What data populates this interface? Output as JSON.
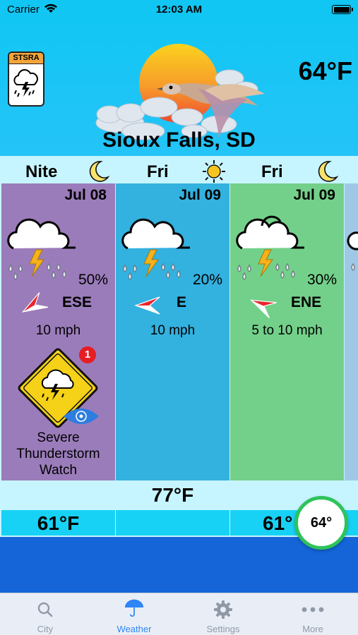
{
  "status_bar": {
    "carrier": "Carrier",
    "time": "12:03 AM"
  },
  "header": {
    "badge_label": "STSRA",
    "current_temp": "64°F",
    "city": "Sioux Falls, SD"
  },
  "forecast": [
    {
      "day": "Nite",
      "day_icon": "moon-icon",
      "date": "Jul 08",
      "precip": "50%",
      "wind_dir": "ESE",
      "wind_speed": "10 mph",
      "alert_count": "1",
      "alert_text": "Severe Thunderstorm Watch",
      "high": "",
      "low": "61°F",
      "panel_color": "#9b7cba"
    },
    {
      "day": "Fri",
      "day_icon": "sun-icon",
      "date": "Jul 09",
      "precip": "20%",
      "wind_dir": "E",
      "wind_speed": "10 mph",
      "high": "77°F",
      "low": "",
      "panel_color": "#33b1df"
    },
    {
      "day": "Fri",
      "day_icon": "moon-icon",
      "date": "Jul 09",
      "precip": "30%",
      "wind_dir": "ENE",
      "wind_speed": "5 to 10 mph",
      "high": "",
      "low": "61°",
      "panel_color": "#73d08a"
    }
  ],
  "fab": {
    "label": "64°"
  },
  "tabs": [
    {
      "label": "City",
      "icon": "search-icon"
    },
    {
      "label": "Weather",
      "icon": "umbrella-icon",
      "active": true
    },
    {
      "label": "Settings",
      "icon": "gear-icon"
    },
    {
      "label": "More",
      "icon": "more-icon"
    }
  ],
  "colors": {
    "sky": "#12c6f3",
    "strip": "#c7f5ff",
    "low_row": "#17d2f5",
    "bottom": "#1565d8",
    "accent": "#2f86f6",
    "fab_ring": "#2ec35a"
  }
}
